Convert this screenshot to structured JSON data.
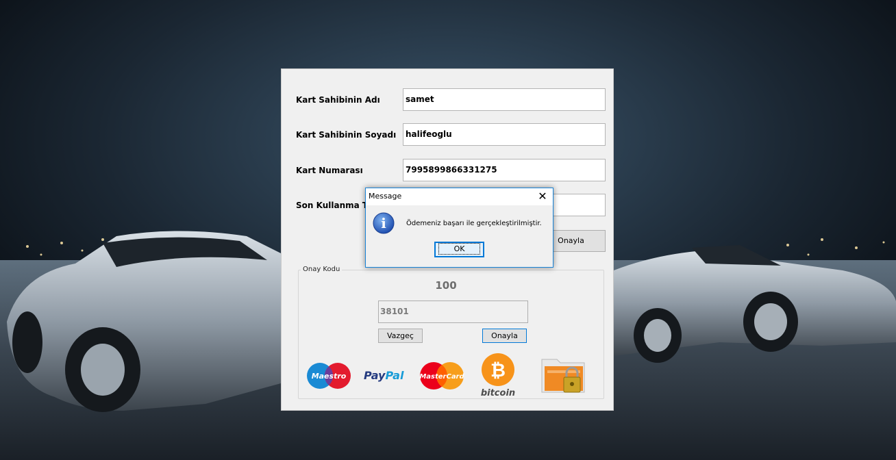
{
  "form": {
    "fields": [
      {
        "label": "Kart Sahibinin Adı",
        "value": "samet"
      },
      {
        "label": "Kart Sahibinin Soyadı",
        "value": "halifeoglu"
      },
      {
        "label": "Kart Numarası",
        "value": "7995899866331275"
      },
      {
        "label": "Son Kullanma Ta",
        "value": ""
      }
    ],
    "confirm_button": "Onayla",
    "group": {
      "title": "Onay Kodu",
      "counter": "100",
      "code_value": "38101",
      "cancel_button": "Vazgeç",
      "confirm_button": "Onayla"
    },
    "logos": {
      "maestro": "Maestro",
      "paypal_pay": "Pay",
      "paypal_pal": "Pal",
      "mastercard": "MasterCard",
      "bitcoin": "bitcoin",
      "bitcoin_symbol": "₿"
    }
  },
  "message_box": {
    "title": "Message",
    "close_glyph": "✕",
    "icon": "info-icon",
    "icon_glyph": "i",
    "text": "Ödemeniz başarı ile gerçekleştirilmiştir.",
    "ok_button": "OK"
  },
  "colors": {
    "window_bg": "#f0f0f0",
    "accent_border": "#0078d7",
    "maestro_blue": "#1a8ad4",
    "maestro_red": "#e31b2e",
    "paypal_dark": "#253b80",
    "paypal_light": "#179bd7",
    "mastercard_red": "#eb001b",
    "mastercard_orange": "#f79e1b",
    "bitcoin_orange": "#f7931a"
  }
}
